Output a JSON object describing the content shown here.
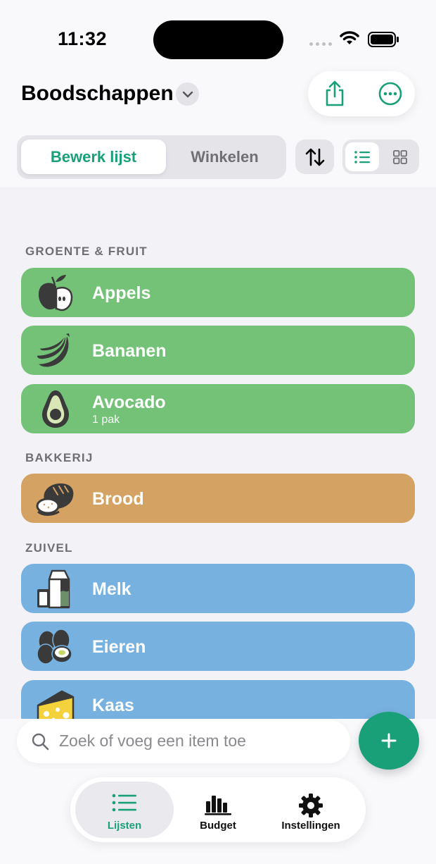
{
  "status_bar": {
    "time": "11:32"
  },
  "header": {
    "title": "Boodschappen",
    "icons": [
      "chevron-down-icon",
      "share-icon",
      "more-icon"
    ]
  },
  "mode_switch": {
    "options": [
      "Bewerk lijst",
      "Winkelen"
    ],
    "selected": "Bewerk lijst"
  },
  "toolbar": {
    "icons": [
      "sort-icon",
      "list-view-icon",
      "grid-view-icon"
    ],
    "selected_view": "list"
  },
  "sections": [
    {
      "title": "GROENTE & FRUIT",
      "color": "#73C277",
      "items": [
        {
          "name": "Appels",
          "icon": "apple-icon"
        },
        {
          "name": "Bananen",
          "icon": "banana-icon"
        },
        {
          "name": "Avocado",
          "detail": "1 pak",
          "icon": "avocado-icon"
        }
      ]
    },
    {
      "title": "BAKKERIJ",
      "color": "#D4A263",
      "items": [
        {
          "name": "Brood",
          "icon": "bread-icon"
        }
      ]
    },
    {
      "title": "ZUIVEL",
      "color": "#77B1DF",
      "items": [
        {
          "name": "Melk",
          "icon": "milk-icon"
        },
        {
          "name": "Eieren",
          "icon": "eggs-icon"
        },
        {
          "name": "Kaas",
          "icon": "cheese-icon"
        }
      ]
    }
  ],
  "search": {
    "placeholder": "Zoek of voeg een item toe"
  },
  "add_button": {
    "icon": "plus-icon"
  },
  "tabs": [
    {
      "label": "Lijsten",
      "icon": "list-icon",
      "active": true
    },
    {
      "label": "Budget",
      "icon": "chart-icon",
      "active": false
    },
    {
      "label": "Instellingen",
      "icon": "gear-icon",
      "active": false
    }
  ],
  "colors": {
    "accent": "#1AA079",
    "fruit": "#73C277",
    "bakery": "#D4A263",
    "dairy": "#77B1DF"
  }
}
